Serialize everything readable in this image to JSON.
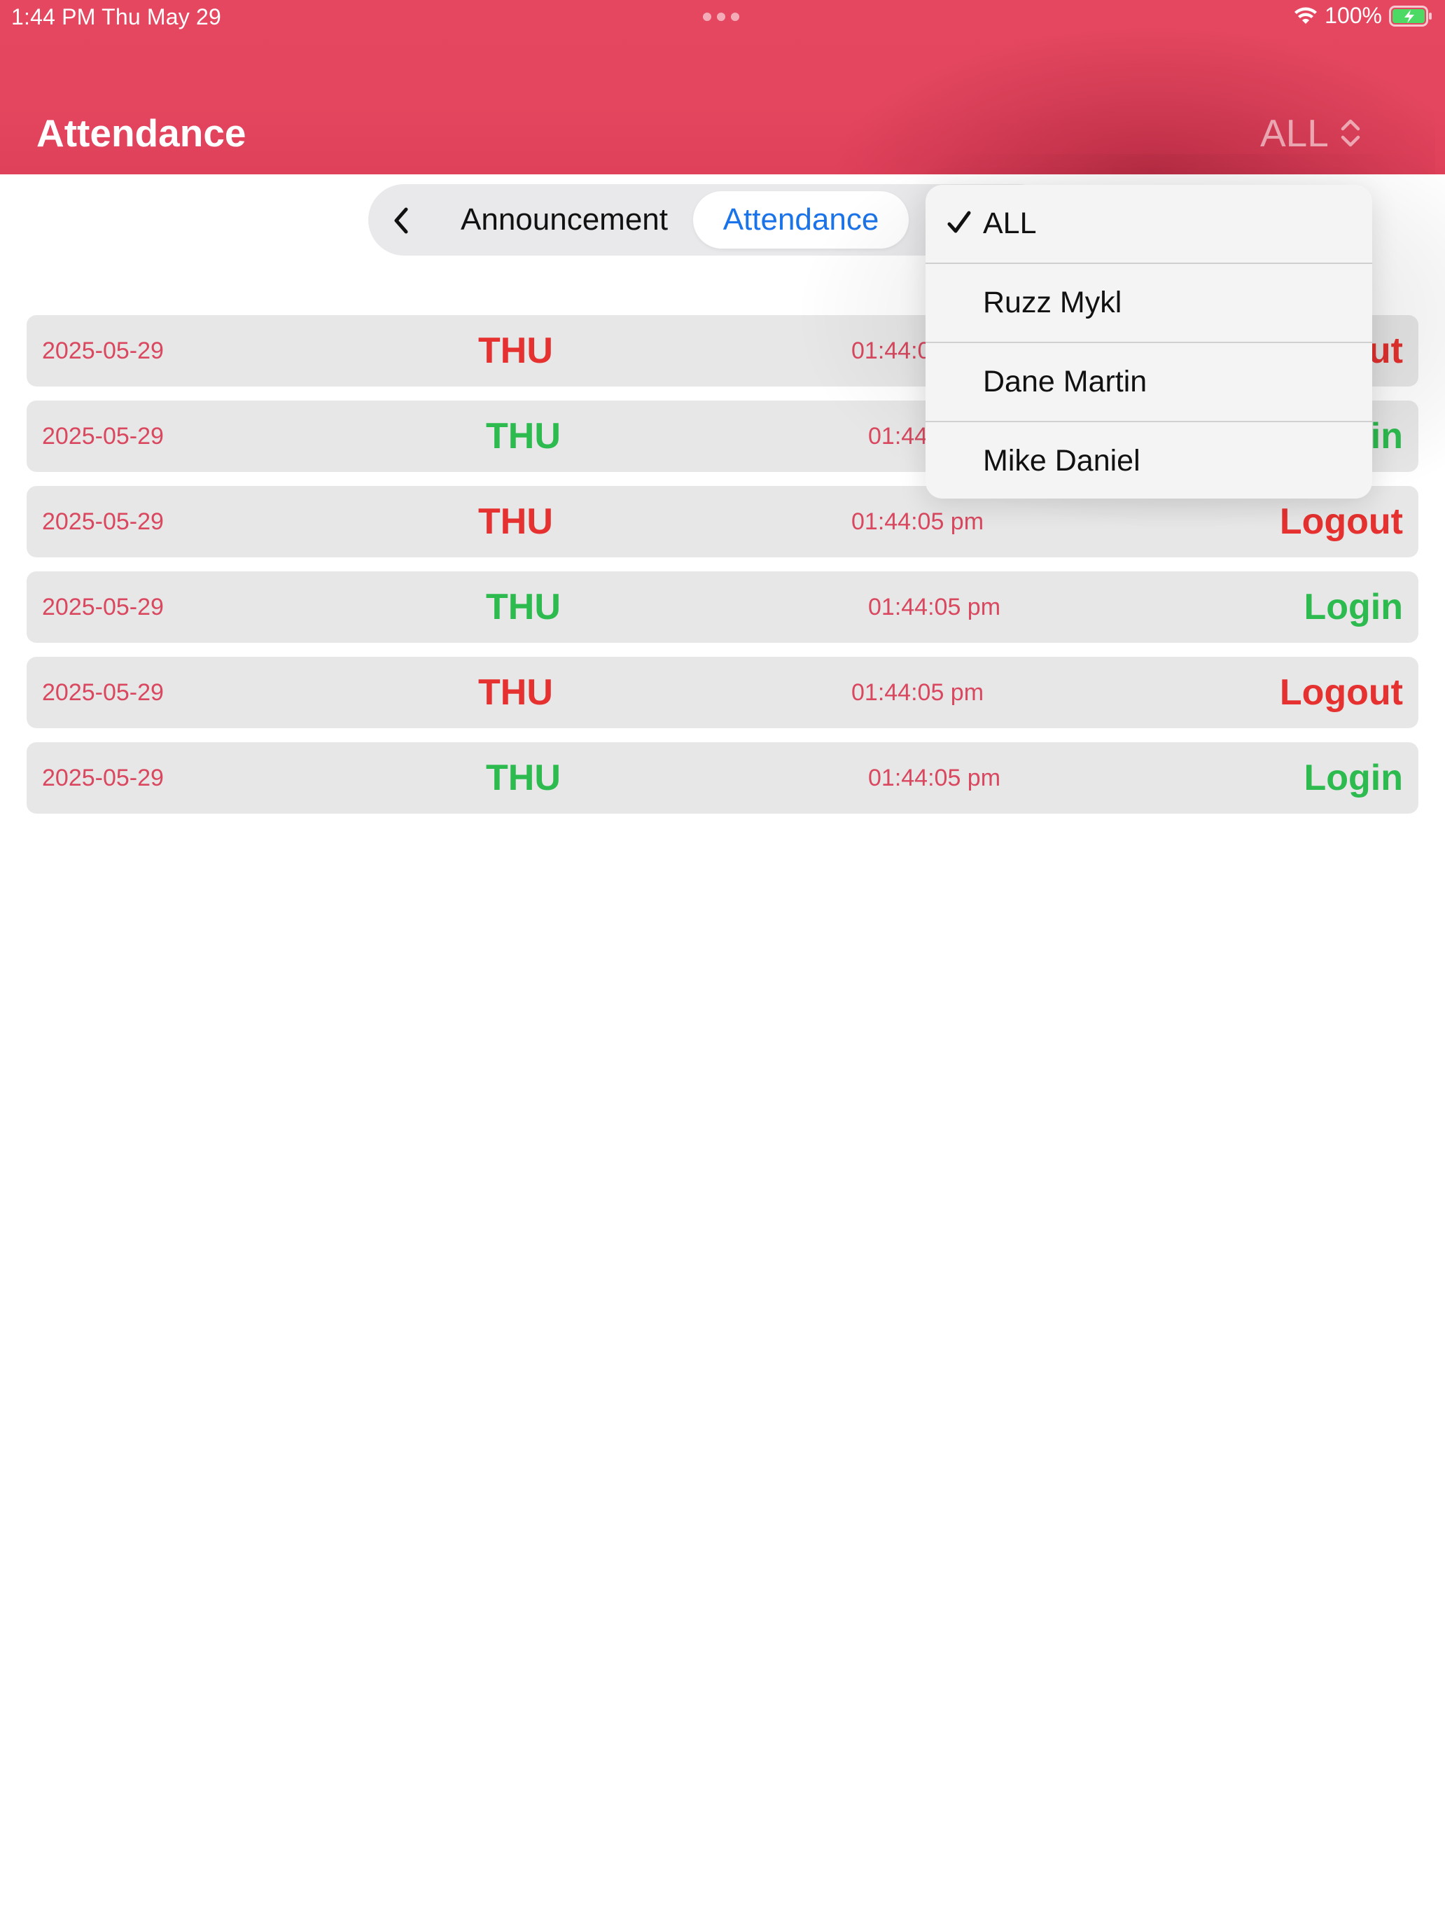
{
  "status_bar": {
    "time_date": "1:44 PM   Thu May 29",
    "battery": "100%"
  },
  "header": {
    "title": "Attendance",
    "filter_value": "ALL"
  },
  "tabs": {
    "announcement": "Announcement",
    "attendance": "Attendance"
  },
  "rows": [
    {
      "date": "2025-05-29",
      "day": "THU",
      "time": "01:44:05 pm",
      "status": "Logout",
      "type": "logout"
    },
    {
      "date": "2025-05-29",
      "day": "THU",
      "time": "01:44:05 pm",
      "status": "Login",
      "type": "login"
    },
    {
      "date": "2025-05-29",
      "day": "THU",
      "time": "01:44:05 pm",
      "status": "Logout",
      "type": "logout"
    },
    {
      "date": "2025-05-29",
      "day": "THU",
      "time": "01:44:05 pm",
      "status": "Login",
      "type": "login"
    },
    {
      "date": "2025-05-29",
      "day": "THU",
      "time": "01:44:05 pm",
      "status": "Logout",
      "type": "logout"
    },
    {
      "date": "2025-05-29",
      "day": "THU",
      "time": "01:44:05 pm",
      "status": "Login",
      "type": "login"
    }
  ],
  "menu": {
    "items": [
      {
        "label": "ALL",
        "selected": true
      },
      {
        "label": "Ruzz Mykl",
        "selected": false
      },
      {
        "label": "Dane Martin",
        "selected": false
      },
      {
        "label": "Mike Daniel",
        "selected": false
      }
    ]
  },
  "colors": {
    "header": "#e4465f",
    "logout": "#e5312f",
    "login": "#2dbb4f",
    "accent_blue": "#1a73e8",
    "date_text": "#d9485f"
  },
  "icons": {
    "back": "chevron-left-icon",
    "filter": "chevron-up-down-icon",
    "check": "checkmark-icon",
    "wifi": "wifi-icon",
    "battery": "battery-charging-icon"
  }
}
